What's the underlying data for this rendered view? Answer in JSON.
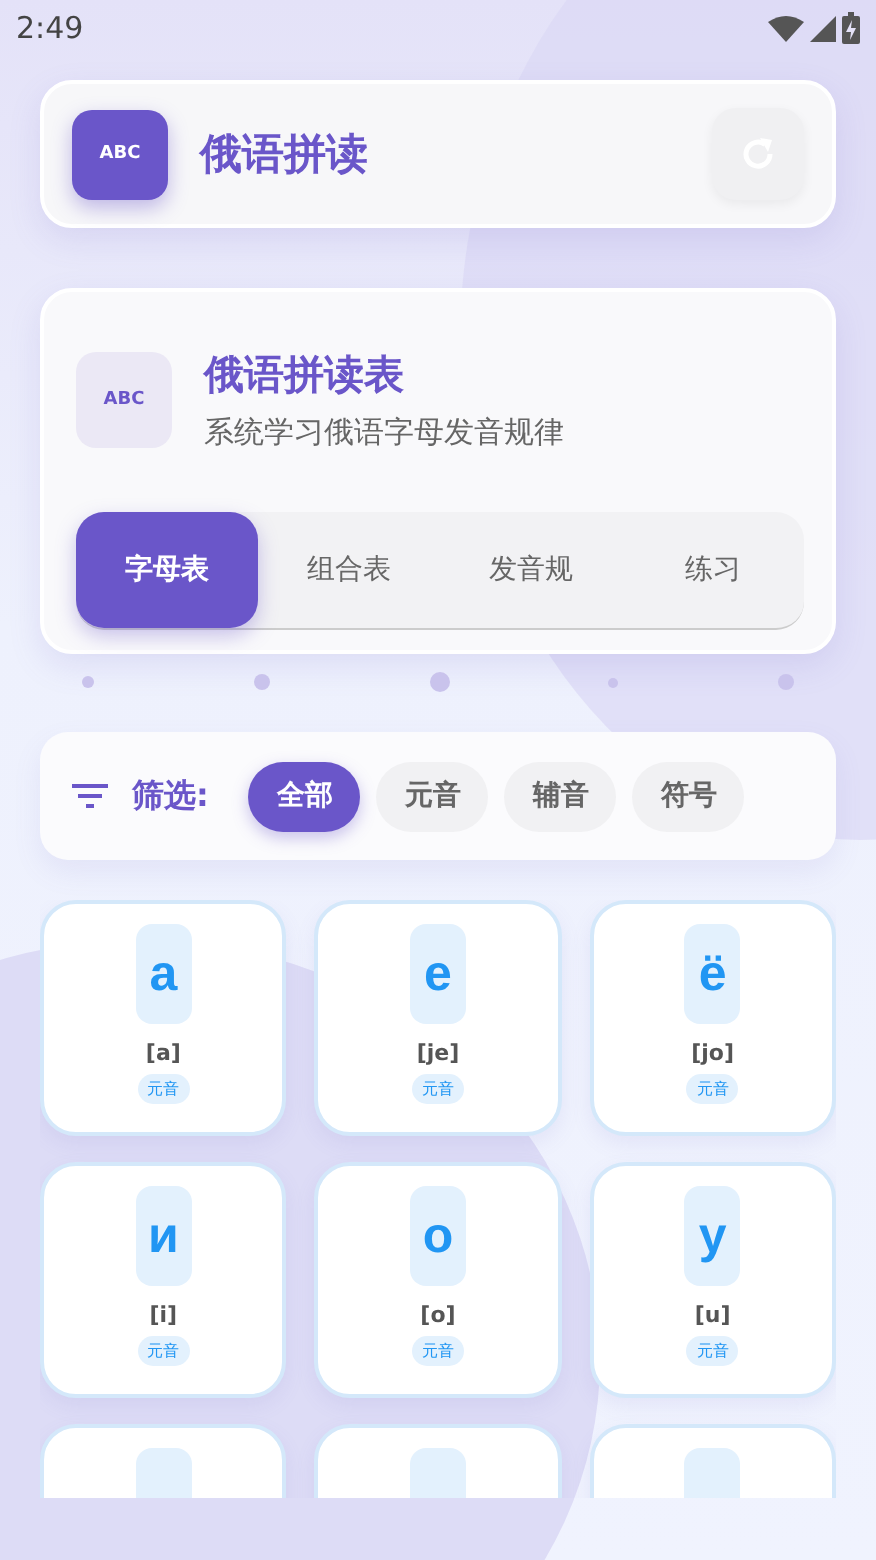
{
  "status_bar": {
    "time": "2:49"
  },
  "header": {
    "logo_text": "ABC",
    "title": "俄语拼读"
  },
  "intro": {
    "logo_text": "ABC",
    "title": "俄语拼读表",
    "subtitle": "系统学习俄语字母发音规律"
  },
  "tabs": [
    {
      "label": "字母表",
      "selected": true
    },
    {
      "label": "组合表",
      "selected": false
    },
    {
      "label": "发音规",
      "selected": false
    },
    {
      "label": "练习",
      "selected": false
    }
  ],
  "filter": {
    "label": "筛选:",
    "options": [
      {
        "label": "全部",
        "selected": true
      },
      {
        "label": "元音",
        "selected": false
      },
      {
        "label": "辅音",
        "selected": false
      },
      {
        "label": "符号",
        "selected": false
      }
    ]
  },
  "letters": [
    {
      "kind": "full",
      "letter": "а",
      "sound": "[a]",
      "tag": "元音"
    },
    {
      "kind": "full",
      "letter": "е",
      "sound": "[je]",
      "tag": "元音"
    },
    {
      "kind": "full",
      "letter": "ё",
      "sound": "[jo]",
      "tag": "元音"
    },
    {
      "kind": "full",
      "letter": "и",
      "sound": "[i]",
      "tag": "元音"
    },
    {
      "kind": "full",
      "letter": "о",
      "sound": "[o]",
      "tag": "元音"
    },
    {
      "kind": "full",
      "letter": "у",
      "sound": "[u]",
      "tag": "元音"
    },
    {
      "kind": "cut"
    },
    {
      "kind": "cut"
    },
    {
      "kind": "cut"
    }
  ]
}
